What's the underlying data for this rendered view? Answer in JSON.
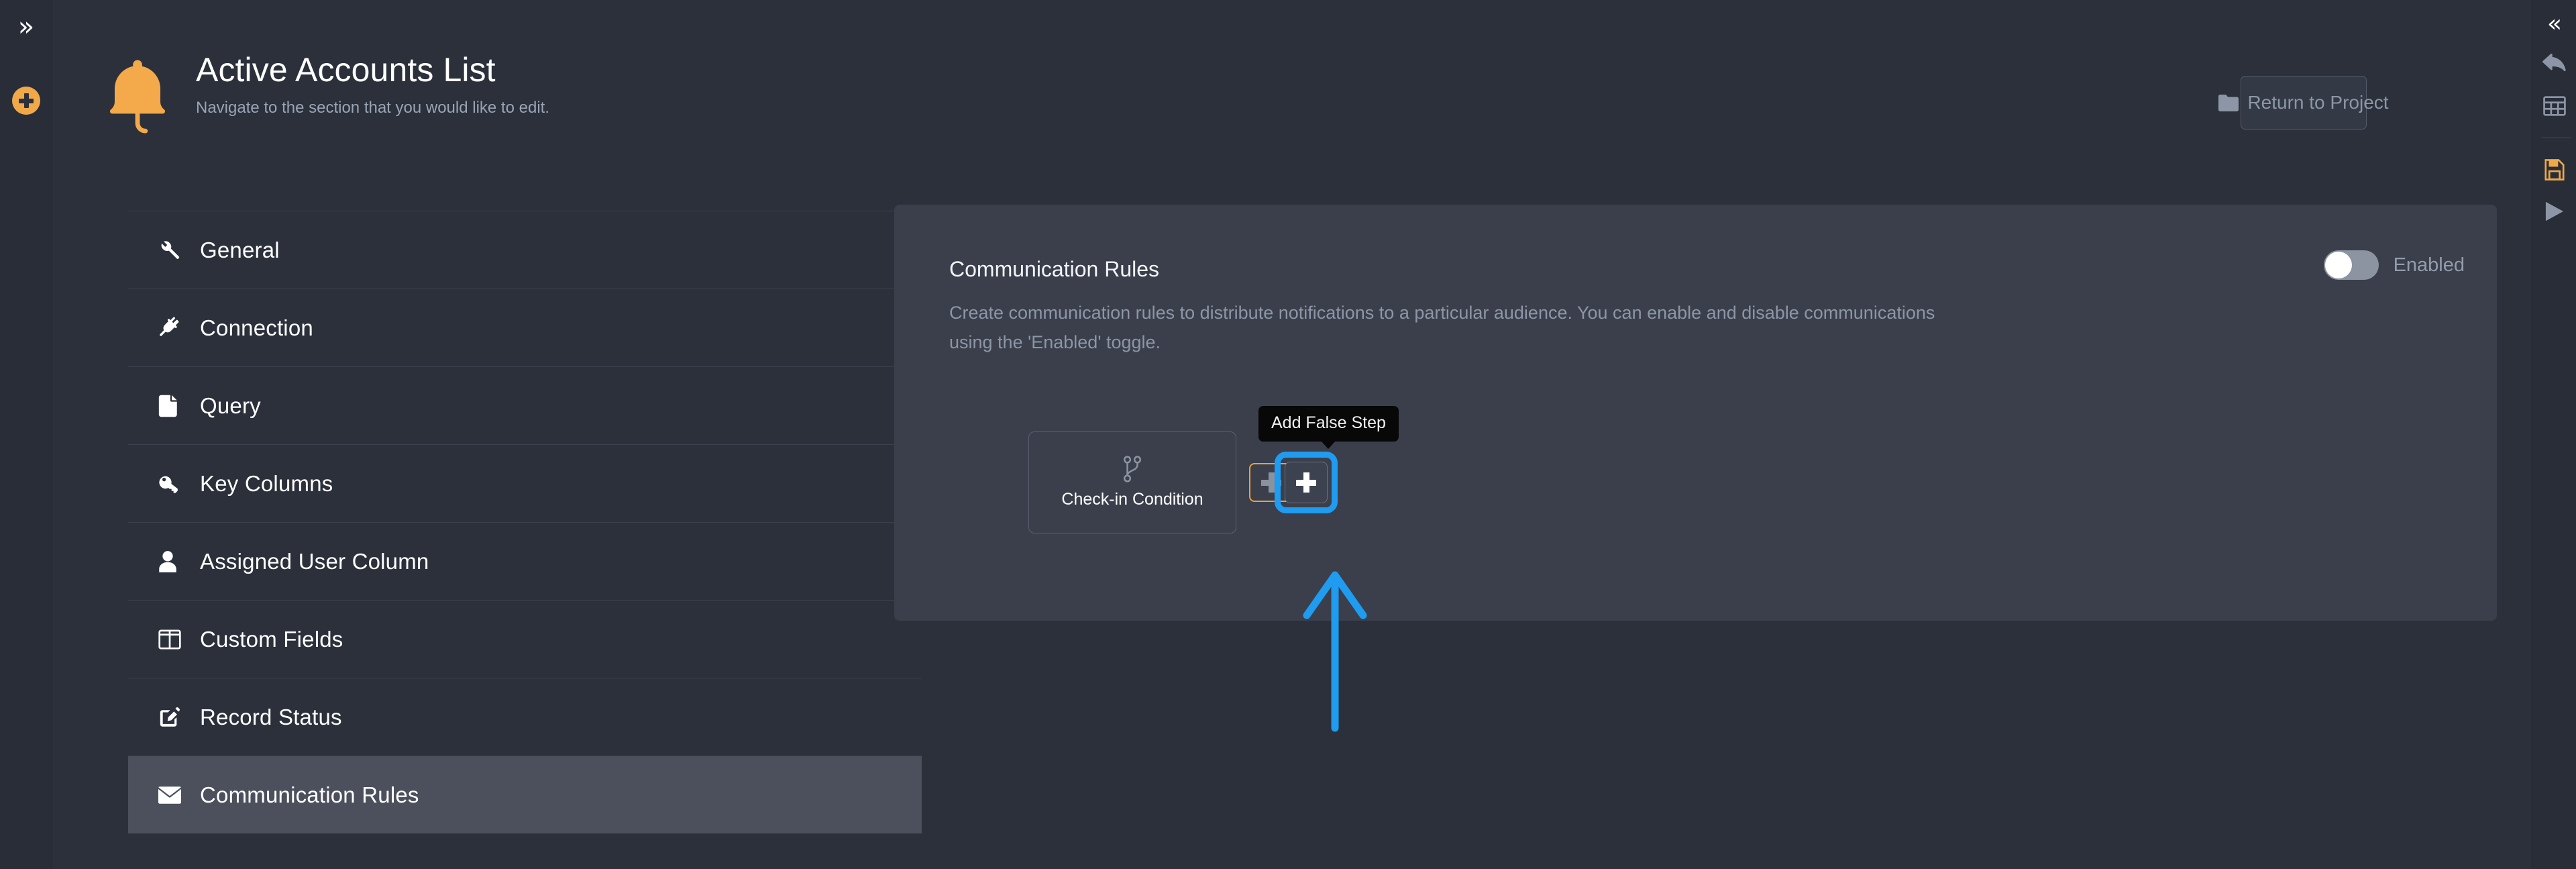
{
  "left_rail": {
    "expand_icon": "chevron-double-right-icon",
    "add_icon": "circle-plus-icon"
  },
  "right_rail": {
    "items": [
      {
        "icon": "chevron-double-left-icon",
        "name": "collapse-panel"
      },
      {
        "icon": "undo-arrow-icon",
        "name": "undo"
      },
      {
        "icon": "table-grid-icon",
        "name": "table-view"
      },
      {
        "icon": "save-floppy-icon",
        "name": "save",
        "color": "#f0a849"
      },
      {
        "icon": "play-triangle-icon",
        "name": "run"
      }
    ]
  },
  "header": {
    "icon": "bell-icon",
    "title": "Active Accounts List",
    "subtitle": "Navigate to the section that you would like to edit.",
    "return_button": {
      "label": "Return to Project",
      "icon": "folder-icon"
    }
  },
  "sidebar": {
    "items": [
      {
        "label": "General",
        "icon": "wrench-icon",
        "active": false
      },
      {
        "label": "Connection",
        "icon": "plug-icon",
        "active": false
      },
      {
        "label": "Query",
        "icon": "file-icon",
        "active": false
      },
      {
        "label": "Key Columns",
        "icon": "key-icon",
        "active": false
      },
      {
        "label": "Assigned User Column",
        "icon": "user-icon",
        "active": false
      },
      {
        "label": "Custom Fields",
        "icon": "columns-icon",
        "active": false
      },
      {
        "label": "Record Status",
        "icon": "edit-square-icon",
        "active": false
      },
      {
        "label": "Communication Rules",
        "icon": "envelope-icon",
        "active": true
      }
    ]
  },
  "main": {
    "title": "Communication Rules",
    "description": "Create communication rules to distribute notifications to a particular audience. You can enable and disable communications using the 'Enabled' toggle.",
    "toggle": {
      "label": "Enabled",
      "state": "off"
    },
    "flow": {
      "condition_node": {
        "label": "Check-in Condition",
        "icon": "code-branch-icon"
      },
      "add_true_button": {
        "icon": "plus-icon",
        "border_color": "#e8a33d"
      },
      "add_false_button": {
        "icon": "plus-icon",
        "tooltip": "Add False Step",
        "focused": true,
        "focus_color": "#1f9bf0"
      }
    }
  },
  "annotation": {
    "arrow_color": "#1f9bf0",
    "points_to": "add-false-step-button"
  },
  "colors": {
    "background": "#2b303b",
    "panel": "#3a3f4b",
    "accent_orange": "#f0a849",
    "accent_blue": "#1f9bf0",
    "text_primary": "#ffffff",
    "text_muted": "#8d96a6"
  }
}
